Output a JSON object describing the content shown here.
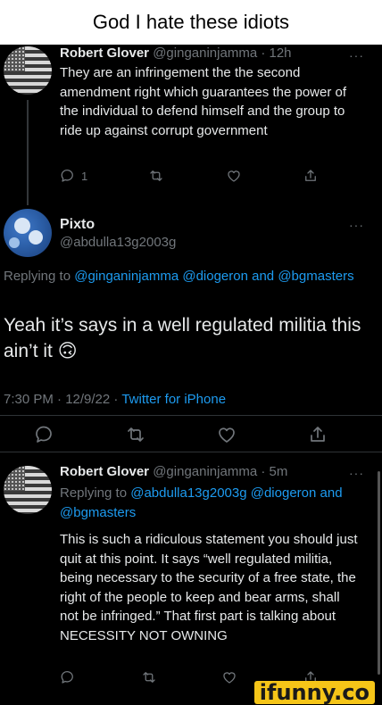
{
  "caption": "God I hate these idiots",
  "tweet1": {
    "name": "Robert Glover",
    "handle": "@ginganinjamma",
    "sep": "·",
    "time": "12h",
    "text": "They are an infringement the the second amendment right which guarantees the power of the individual to defend himself and the group to ride up against corrupt government",
    "reply_count": "1"
  },
  "main": {
    "name": "Pixto",
    "handle": "@abdulla13g2003g",
    "replying_prefix": "Replying to",
    "mention1": "@ginganinjamma",
    "mention2": "@diogeron",
    "and": "and",
    "mention3": "@bgmasters",
    "text": "Yeah it’s says in a well regulated militia this ain’t it",
    "emoji": "🙃",
    "timestamp": "7:30 PM · 12/9/22 ·",
    "client": "Twitter for iPhone"
  },
  "tweet3": {
    "name": "Robert Glover",
    "handle": "@ginganinjamma",
    "sep": "·",
    "time": "5m",
    "replying_prefix": "Replying to",
    "mention1": "@abdulla13g2003g",
    "mention2": "@diogeron",
    "and": "and",
    "mention3": "@bgmasters",
    "text": "This is such a ridiculous statement you should just quit at this point. It says “well regulated militia, being necessary to the security of a free state, the right of the people to keep and bear arms, shall not be infringed.” That first part is talking about NECESSITY NOT OWNING"
  },
  "more": "···",
  "watermark": "ifunny.co",
  "icons": {
    "reply": "reply-icon",
    "retweet": "retweet-icon",
    "like": "heart-icon",
    "share": "share-icon",
    "more": "more-icon"
  },
  "colors": {
    "background": "#000000",
    "link": "#1d9bf0",
    "muted": "#71767b",
    "text": "#e7e9ea"
  }
}
